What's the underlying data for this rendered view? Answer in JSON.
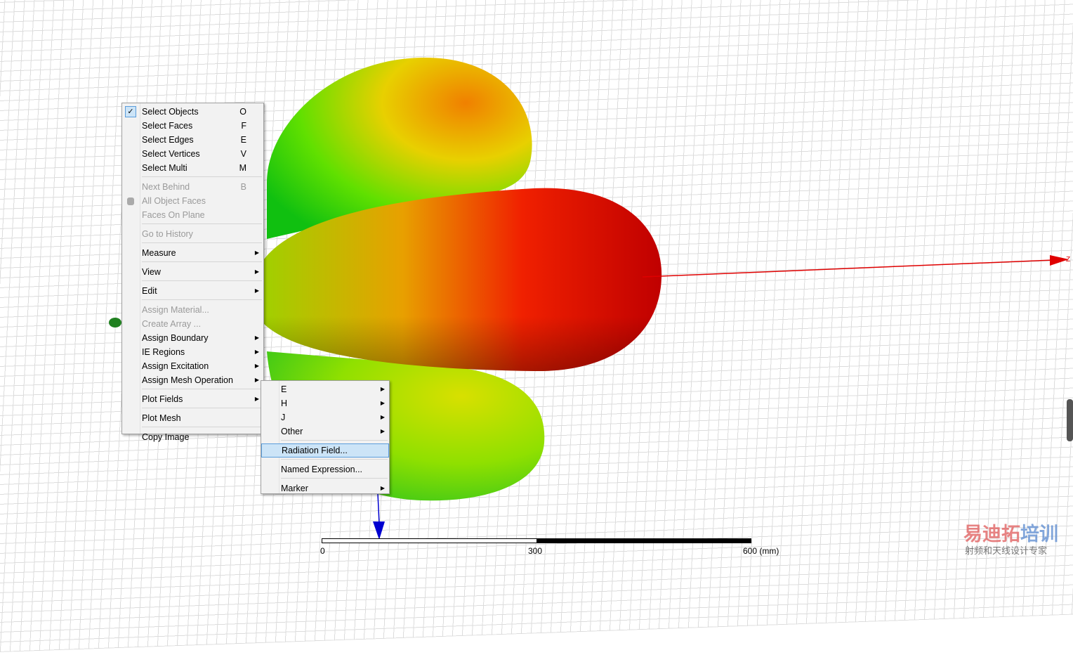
{
  "context_menu": {
    "items": [
      {
        "label": "Select Objects",
        "shortcut": "O",
        "checked": true
      },
      {
        "label": "Select Faces",
        "shortcut": "F"
      },
      {
        "label": "Select Edges",
        "shortcut": "E"
      },
      {
        "label": "Select Vertices",
        "shortcut": "V"
      },
      {
        "label": "Select Multi",
        "shortcut": "M"
      },
      {
        "label": "Next Behind",
        "shortcut": "B",
        "disabled": true
      },
      {
        "label": "All Object Faces",
        "disabled": true
      },
      {
        "label": "Faces On Plane",
        "disabled": true
      },
      {
        "label": "Go to History",
        "disabled": true
      },
      {
        "label": "Measure",
        "submenu": true
      },
      {
        "label": "View",
        "submenu": true
      },
      {
        "label": "Edit",
        "submenu": true
      },
      {
        "label": "Assign Material...",
        "disabled": true
      },
      {
        "label": "Create Array ...",
        "disabled": true
      },
      {
        "label": "Assign Boundary",
        "submenu": true
      },
      {
        "label": "IE Regions",
        "submenu": true
      },
      {
        "label": "Assign Excitation",
        "submenu": true
      },
      {
        "label": "Assign Mesh Operation",
        "submenu": true
      },
      {
        "label": "Plot Fields",
        "submenu": true
      },
      {
        "label": "Plot Mesh"
      },
      {
        "label": "Copy Image"
      }
    ]
  },
  "plot_fields_submenu": {
    "items": [
      {
        "label": "E"
      },
      {
        "label": "H"
      },
      {
        "label": "J"
      },
      {
        "label": "Other"
      },
      {
        "label": "Radiation Field..."
      },
      {
        "label": "Named Expression..."
      },
      {
        "label": "Marker"
      }
    ],
    "highlighted": "Radiation Field..."
  },
  "scale": {
    "ticks": [
      "0",
      "300",
      "600 (mm)"
    ]
  },
  "axis": {
    "z_label": "Z"
  },
  "watermark": {
    "line1a": "易迪拓",
    "line1b": "培训",
    "line2": "射频和天线设计专家"
  }
}
